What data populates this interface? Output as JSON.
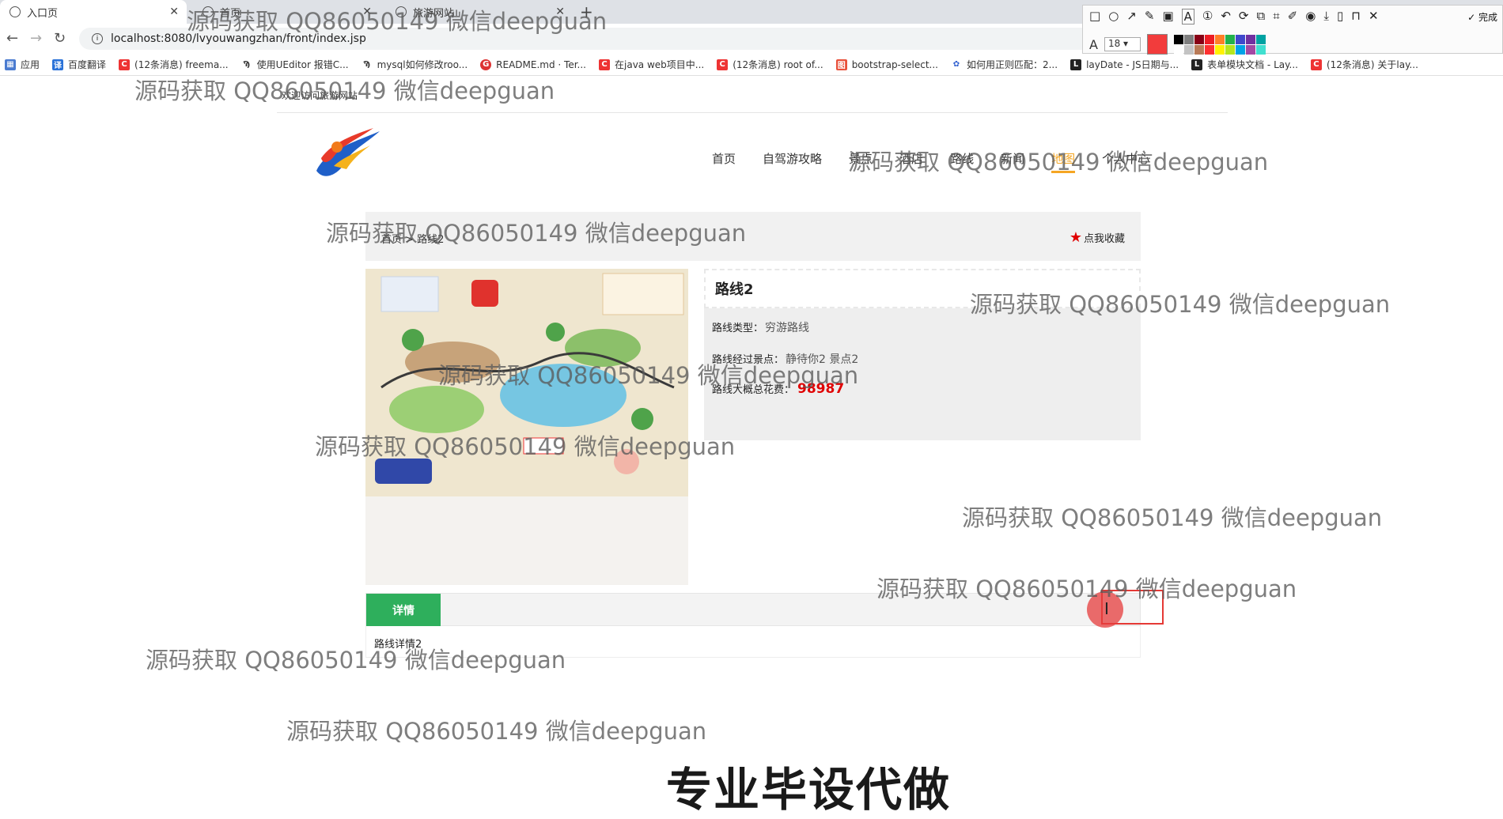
{
  "browser": {
    "tabs": [
      {
        "title": "入口页",
        "active": true
      },
      {
        "title": "首页",
        "active": false
      },
      {
        "title": "旅游网站",
        "active": false
      }
    ],
    "url": "localhost:8080/lvyouwangzhan/front/index.jsp",
    "bookmarks": [
      {
        "icon": "apps-icon",
        "label": "应用"
      },
      {
        "icon": "translate-icon",
        "label": "百度翻译"
      },
      {
        "icon": "csdn-icon",
        "label": "(12条消息) freema..."
      },
      {
        "icon": "bookmark-icon",
        "label": "使用UEditor 报错C..."
      },
      {
        "icon": "bookmark-icon",
        "label": "mysql如何修改roo..."
      },
      {
        "icon": "github-icon",
        "label": "README.md · Ter..."
      },
      {
        "icon": "csdn-icon",
        "label": "在java web项目中..."
      },
      {
        "icon": "csdn-icon",
        "label": "(12条消息) root of..."
      },
      {
        "icon": "bootstrap-icon",
        "label": "bootstrap-select..."
      },
      {
        "icon": "baidu-icon",
        "label": "如何用正则匹配：2..."
      },
      {
        "icon": "layui-icon",
        "label": "layDate - JS日期与..."
      },
      {
        "icon": "layui-icon",
        "label": "表单模块文档 - Lay..."
      },
      {
        "icon": "csdn-icon",
        "label": "(12条消息) 关于lay..."
      }
    ]
  },
  "screenshot_tool": {
    "font_size": "18",
    "done_label": "完成",
    "current_color": "#f23c3c",
    "palette": [
      "#000000",
      "#7f7f7f",
      "#880015",
      "#ed1c24",
      "#ff7f27",
      "#22b14c",
      "#3f48cc",
      "#7030a0",
      "#00a2a2",
      "#ffffff",
      "#c3c3c3",
      "#b97a57",
      "#ff3030",
      "#fff200",
      "#b5e61d",
      "#00a2e8",
      "#a349a4",
      "#40e0d0"
    ]
  },
  "page": {
    "welcome": "欢迎访问旅游网站",
    "nav": [
      {
        "label": "首页",
        "current": false
      },
      {
        "label": "自驾游攻略",
        "current": false
      },
      {
        "label": "景点",
        "current": false
      },
      {
        "label": "酒店",
        "current": false
      },
      {
        "label": "路线",
        "current": false
      },
      {
        "label": "新闻",
        "current": false
      },
      {
        "label": "地图",
        "current": true
      },
      {
        "label": "个人中心",
        "current": false
      }
    ],
    "breadcrumb": "首页 > 路线2",
    "favorite_label": "点我收藏",
    "route": {
      "title": "路线2",
      "type_label": "路线类型：",
      "type_value": "穷游路线",
      "spots_label": "路线经过景点：",
      "spots_value": "静待你2 景点2",
      "cost_label": "路线大概总花费：",
      "cost_value": "98987"
    },
    "detail_tab": "详情",
    "detail_text": "路线详情2"
  },
  "watermark": "源码获取 QQ86050149 微信deepguan",
  "caption": "专业毕设代做"
}
